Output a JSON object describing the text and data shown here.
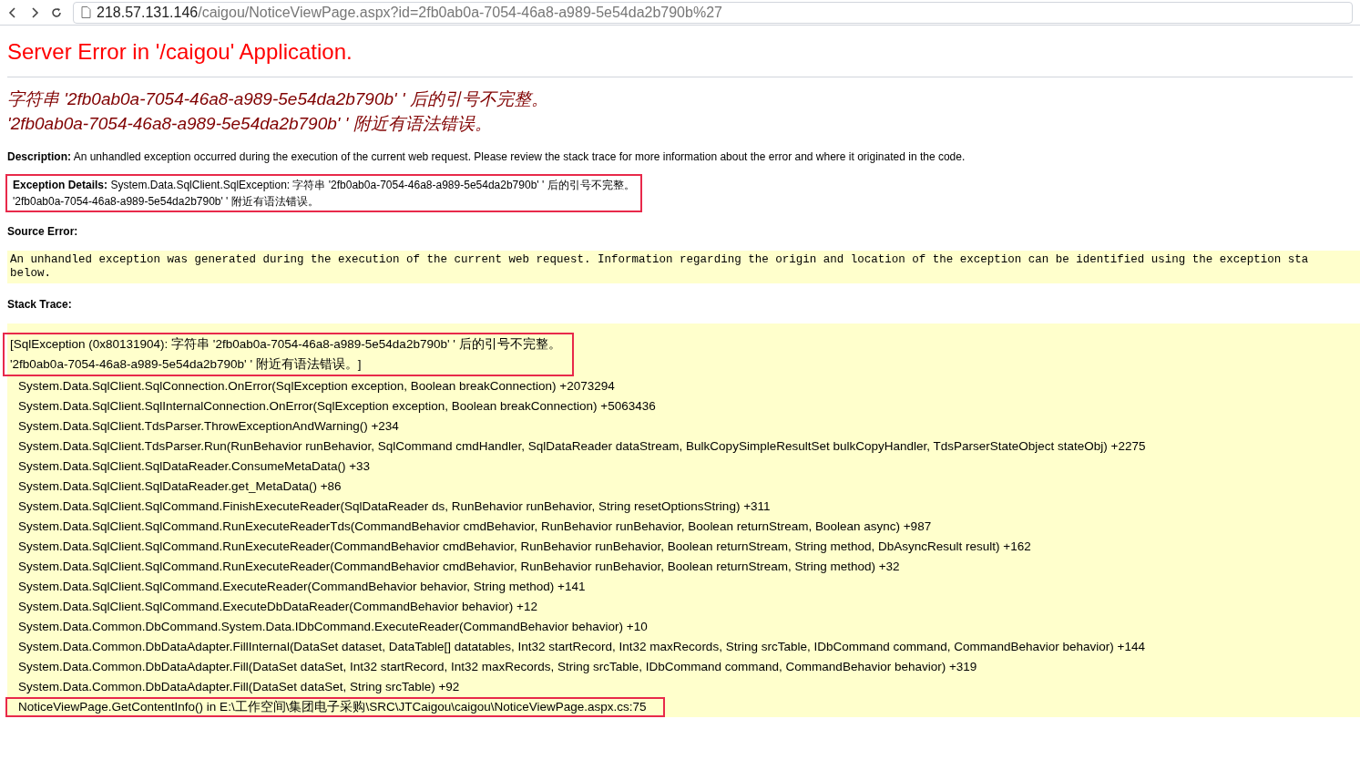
{
  "browser": {
    "url_host": "218.57.131.146",
    "url_path": "/caigou/NoticeViewPage.aspx?id=2fb0ab0a-7054-46a8-a989-5e54da2b790b%27"
  },
  "page": {
    "title": "Server Error in '/caigou' Application.",
    "error_lines": [
      "字符串 '2fb0ab0a-7054-46a8-a989-5e54da2b790b' ' 后的引号不完整。",
      "'2fb0ab0a-7054-46a8-a989-5e54da2b790b' ' 附近有语法错误。"
    ],
    "description": {
      "label": "Description:",
      "text": "An unhandled exception occurred during the execution of the current web request. Please review the stack trace for more information about the error and where it originated in the code."
    },
    "exception_details": {
      "label": "Exception Details:",
      "highlighted": true,
      "lines": [
        "System.Data.SqlClient.SqlException: 字符串 '2fb0ab0a-7054-46a8-a989-5e54da2b790b' ' 后的引号不完整。",
        "'2fb0ab0a-7054-46a8-a989-5e54da2b790b' ' 附近有语法错误。"
      ]
    },
    "source_error": {
      "label": "Source Error:",
      "lines": [
        "An unhandled exception was generated during the execution of the current web request. Information regarding the origin and location of the exception can be identified using the exception sta",
        "below."
      ]
    },
    "stack_trace": {
      "label": "Stack Trace:",
      "exception_highlighted": true,
      "exception_lines": [
        "[SqlException (0x80131904): 字符串 '2fb0ab0a-7054-46a8-a989-5e54da2b790b' ' 后的引号不完整。",
        "'2fb0ab0a-7054-46a8-a989-5e54da2b790b' ' 附近有语法错误。]"
      ],
      "frames": [
        {
          "text": "System.Data.SqlClient.SqlConnection.OnError(SqlException exception, Boolean breakConnection) +2073294",
          "highlighted": false
        },
        {
          "text": "System.Data.SqlClient.SqlInternalConnection.OnError(SqlException exception, Boolean breakConnection) +5063436",
          "highlighted": false
        },
        {
          "text": "System.Data.SqlClient.TdsParser.ThrowExceptionAndWarning() +234",
          "highlighted": false
        },
        {
          "text": "System.Data.SqlClient.TdsParser.Run(RunBehavior runBehavior, SqlCommand cmdHandler, SqlDataReader dataStream, BulkCopySimpleResultSet bulkCopyHandler, TdsParserStateObject stateObj) +2275",
          "highlighted": false
        },
        {
          "text": "System.Data.SqlClient.SqlDataReader.ConsumeMetaData() +33",
          "highlighted": false
        },
        {
          "text": "System.Data.SqlClient.SqlDataReader.get_MetaData() +86",
          "highlighted": false
        },
        {
          "text": "System.Data.SqlClient.SqlCommand.FinishExecuteReader(SqlDataReader ds, RunBehavior runBehavior, String resetOptionsString) +311",
          "highlighted": false
        },
        {
          "text": "System.Data.SqlClient.SqlCommand.RunExecuteReaderTds(CommandBehavior cmdBehavior, RunBehavior runBehavior, Boolean returnStream, Boolean async) +987",
          "highlighted": false
        },
        {
          "text": "System.Data.SqlClient.SqlCommand.RunExecuteReader(CommandBehavior cmdBehavior, RunBehavior runBehavior, Boolean returnStream, String method, DbAsyncResult result) +162",
          "highlighted": false
        },
        {
          "text": "System.Data.SqlClient.SqlCommand.RunExecuteReader(CommandBehavior cmdBehavior, RunBehavior runBehavior, Boolean returnStream, String method) +32",
          "highlighted": false
        },
        {
          "text": "System.Data.SqlClient.SqlCommand.ExecuteReader(CommandBehavior behavior, String method) +141",
          "highlighted": false
        },
        {
          "text": "System.Data.SqlClient.SqlCommand.ExecuteDbDataReader(CommandBehavior behavior) +12",
          "highlighted": false
        },
        {
          "text": "System.Data.Common.DbCommand.System.Data.IDbCommand.ExecuteReader(CommandBehavior behavior) +10",
          "highlighted": false
        },
        {
          "text": "System.Data.Common.DbDataAdapter.FillInternal(DataSet dataset, DataTable[] datatables, Int32 startRecord, Int32 maxRecords, String srcTable, IDbCommand command, CommandBehavior behavior) +144",
          "highlighted": false
        },
        {
          "text": "System.Data.Common.DbDataAdapter.Fill(DataSet dataSet, Int32 startRecord, Int32 maxRecords, String srcTable, IDbCommand command, CommandBehavior behavior) +319",
          "highlighted": false
        },
        {
          "text": "System.Data.Common.DbDataAdapter.Fill(DataSet dataSet, String srcTable) +92",
          "highlighted": false
        },
        {
          "text": "NoticeViewPage.GetContentInfo() in E:\\工作空间\\集团电子采购\\SRC\\JTCaigou\\caigou\\NoticeViewPage.aspx.cs:75",
          "highlighted": true
        }
      ]
    }
  }
}
